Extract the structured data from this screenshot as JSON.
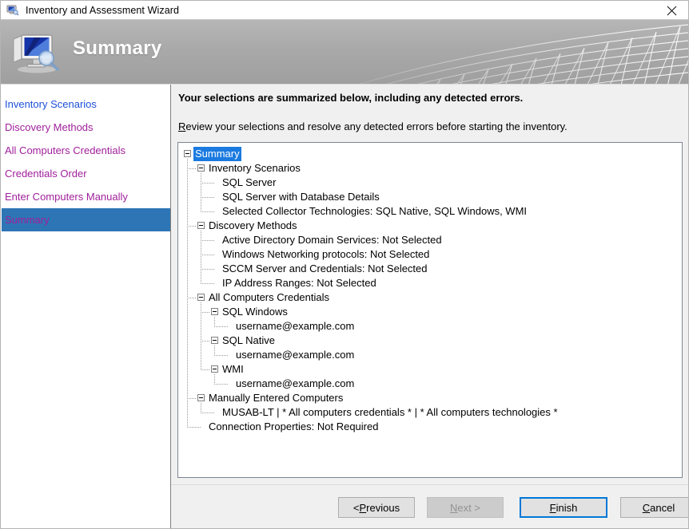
{
  "window": {
    "title": "Inventory and Assessment Wizard",
    "icon": "computer-icon",
    "close_label": "✕"
  },
  "banner": {
    "title": "Summary",
    "icon": "computer-magnifier-icon"
  },
  "sidebar": {
    "items": [
      {
        "label": "Inventory Scenarios",
        "state": "unvisited"
      },
      {
        "label": "Discovery Methods",
        "state": "visited"
      },
      {
        "label": "All Computers Credentials",
        "state": "visited"
      },
      {
        "label": "Credentials Order",
        "state": "visited"
      },
      {
        "label": "Enter Computers Manually",
        "state": "visited"
      },
      {
        "label": "Summary",
        "state": "selected"
      }
    ]
  },
  "content": {
    "headline": "Your selections are summarized below, including any detected errors.",
    "subline_accel": "R",
    "subline_rest": "eview your selections and resolve any detected errors before starting the inventory.",
    "tree": {
      "root": "Summary",
      "nodes": [
        {
          "label": "Summary",
          "level": 0,
          "expander": true,
          "selected": true
        },
        {
          "label": "Inventory Scenarios",
          "level": 1,
          "expander": true,
          "selected": false
        },
        {
          "label": "SQL Server",
          "level": 2,
          "expander": false,
          "selected": false
        },
        {
          "label": "SQL Server with Database Details",
          "level": 2,
          "expander": false,
          "selected": false
        },
        {
          "label": "Selected Collector Technologies: SQL Native, SQL Windows, WMI",
          "level": 2,
          "expander": false,
          "selected": false
        },
        {
          "label": "Discovery Methods",
          "level": 1,
          "expander": true,
          "selected": false
        },
        {
          "label": "Active Directory Domain Services: Not Selected",
          "level": 2,
          "expander": false,
          "selected": false
        },
        {
          "label": "Windows Networking protocols: Not Selected",
          "level": 2,
          "expander": false,
          "selected": false
        },
        {
          "label": "SCCM Server and Credentials: Not Selected",
          "level": 2,
          "expander": false,
          "selected": false
        },
        {
          "label": "IP Address Ranges: Not Selected",
          "level": 2,
          "expander": false,
          "selected": false
        },
        {
          "label": "All Computers Credentials",
          "level": 1,
          "expander": true,
          "selected": false
        },
        {
          "label": "SQL Windows",
          "level": 2,
          "expander": true,
          "selected": false
        },
        {
          "label": "username@example.com",
          "level": 3,
          "expander": false,
          "selected": false
        },
        {
          "label": "SQL Native",
          "level": 2,
          "expander": true,
          "selected": false
        },
        {
          "label": "username@example.com",
          "level": 3,
          "expander": false,
          "selected": false
        },
        {
          "label": "WMI",
          "level": 2,
          "expander": true,
          "selected": false
        },
        {
          "label": "username@example.com",
          "level": 3,
          "expander": false,
          "selected": false
        },
        {
          "label": "Manually Entered Computers",
          "level": 1,
          "expander": true,
          "selected": false
        },
        {
          "label": "MUSAB-LT | * All computers credentials * | * All computers technologies *",
          "level": 2,
          "expander": false,
          "selected": false
        },
        {
          "label": "Connection Properties: Not Required",
          "level": 1,
          "expander": false,
          "selected": false
        }
      ]
    }
  },
  "footer": {
    "buttons": [
      {
        "name": "previous",
        "pre": "< ",
        "accel": "P",
        "post": "revious",
        "state": "enabled"
      },
      {
        "name": "next",
        "pre": "",
        "accel": "N",
        "post": "ext >",
        "state": "disabled"
      },
      {
        "name": "finish",
        "pre": "",
        "accel": "F",
        "post": "inish",
        "state": "default"
      },
      {
        "name": "cancel",
        "pre": "",
        "accel": "C",
        "post": "ancel",
        "state": "enabled"
      }
    ]
  },
  "colors": {
    "accent_blue": "#2e75b6",
    "selection_blue": "#1a7ae0",
    "link_unvisited": "#1d4fd8",
    "link_visited": "#a0219b",
    "default_button_border": "#0078d7",
    "banner_gray": "#a9a9a9",
    "panel_gray": "#f0f0f0"
  }
}
